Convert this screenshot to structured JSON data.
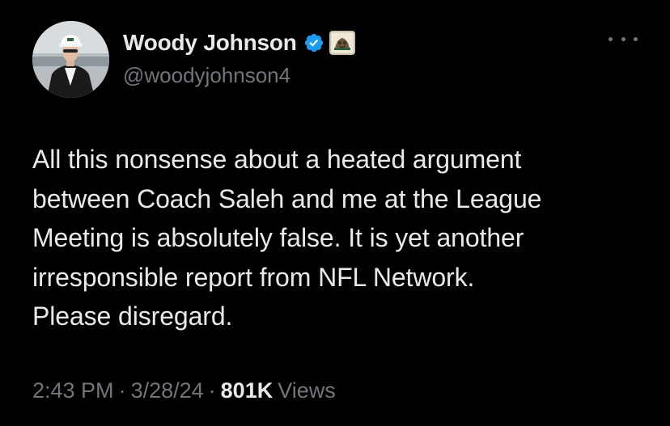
{
  "author": {
    "display_name": "Woody Johnson",
    "handle": "@woodyjohnson4",
    "verified_icon": "verified-badge-icon",
    "affiliate_icon": "affiliate-badge-icon",
    "avatar": "profile-photo"
  },
  "tweet": {
    "text": "All this nonsense about a heated argument\nbetween Coach Saleh and me at the League\nMeeting is absolutely false.  It is yet another\nirresponsible report from NFL Network.\nPlease disregard."
  },
  "meta": {
    "time": "2:43 PM",
    "separator": "·",
    "date": "3/28/24",
    "views_count": "801K",
    "views_label": "Views"
  },
  "more_icon": "more-options-icon",
  "colors": {
    "background": "#000000",
    "primary_text": "#e7e9ea",
    "secondary_text": "#71767b",
    "verified_blue": "#1d9bf0"
  }
}
